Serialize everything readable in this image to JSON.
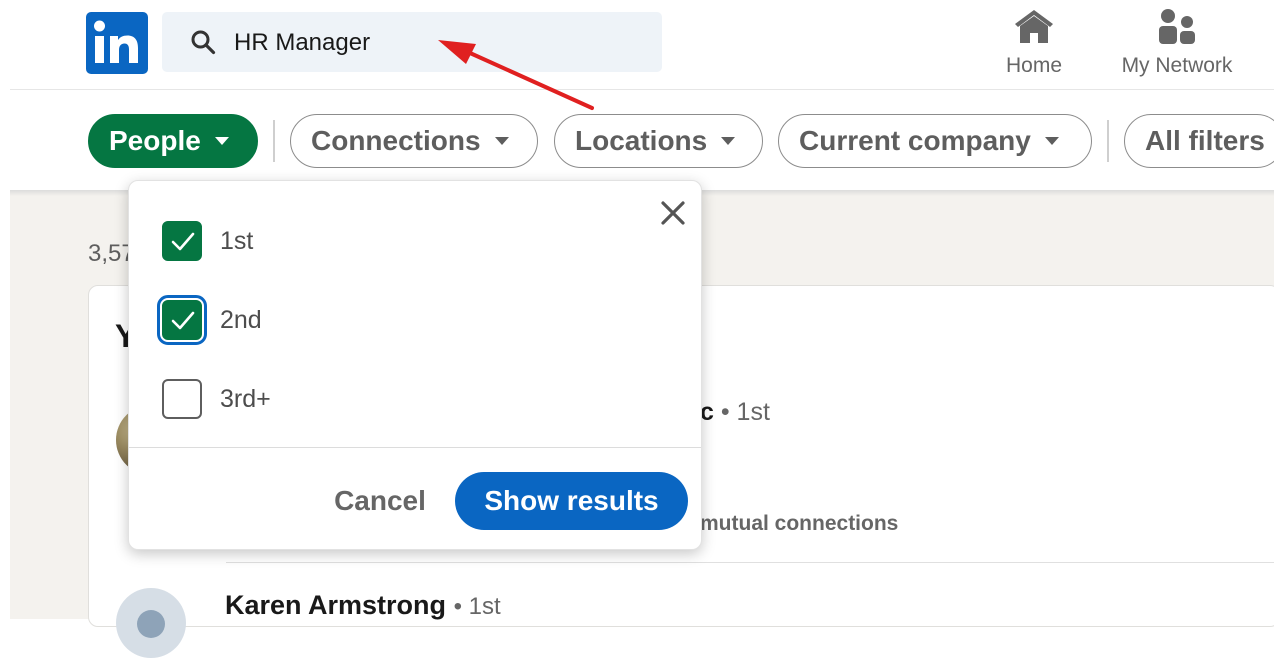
{
  "header": {
    "logo_text": "in",
    "search": {
      "value": "HR Manager",
      "icon": "search-icon"
    },
    "nav": [
      {
        "label": "Home",
        "icon": "home-icon"
      },
      {
        "label": "My Network",
        "icon": "my-network-icon"
      }
    ]
  },
  "filters": [
    {
      "label": "People",
      "active": true
    },
    {
      "label": "Connections",
      "active": false
    },
    {
      "label": "Locations",
      "active": false
    },
    {
      "label": "Current company",
      "active": false
    },
    {
      "label": "All filters",
      "active": false
    }
  ],
  "results": {
    "count_fragment": "3,57",
    "heading_fragment": "Y",
    "rows": [
      {
        "name_fragment": "c",
        "degree": "• 1st",
        "mutual_fragment": "mutual connections"
      },
      {
        "name": "Karen Armstrong",
        "degree": "• 1st"
      }
    ]
  },
  "dropdown": {
    "options": [
      {
        "label": "1st",
        "checked": true
      },
      {
        "label": "2nd",
        "checked": true,
        "focused": true
      },
      {
        "label": "3rd+",
        "checked": false
      }
    ],
    "cancel_label": "Cancel",
    "show_label": "Show results"
  },
  "colors": {
    "brand_blue": "#0a66c2",
    "active_green": "#057642",
    "annotation_red": "#e02020"
  }
}
